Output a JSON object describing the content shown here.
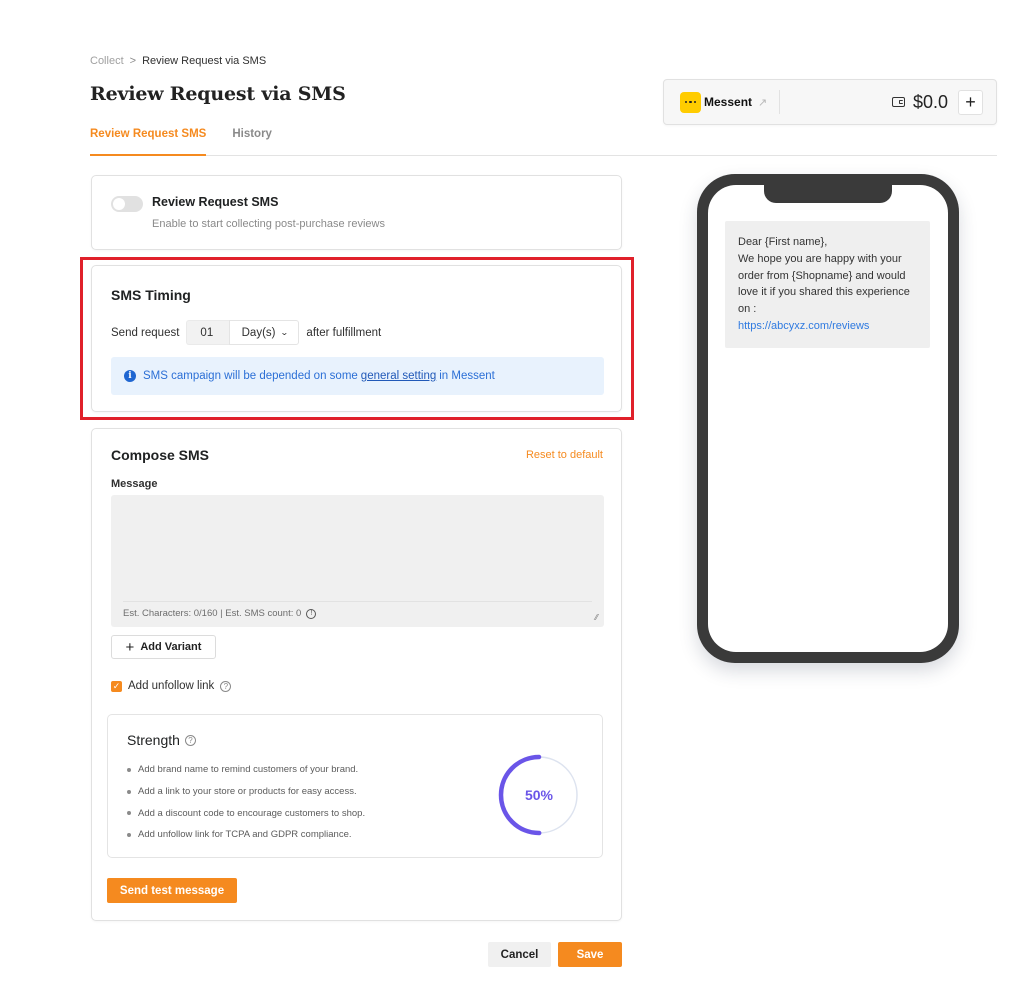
{
  "breadcrumb": {
    "parent": "Collect",
    "separator": ">",
    "current": "Review Request via SMS"
  },
  "page": {
    "title": "Review Request via SMS"
  },
  "tabs": [
    {
      "label": "Review Request SMS",
      "active": true
    },
    {
      "label": "History",
      "active": false
    }
  ],
  "wallet": {
    "brand_name": "Messent",
    "external_link_icon": "external-link-icon",
    "wallet_icon": "wallet-icon",
    "balance": "$0.0",
    "add_label": "+"
  },
  "review_toggle": {
    "title": "Review Request SMS",
    "description": "Enable to start collecting post-purchase reviews",
    "enabled": false
  },
  "timing": {
    "title": "SMS Timing",
    "prefix": "Send request",
    "amount": "01",
    "unit": "Day(s)",
    "suffix": "after fulfillment",
    "info_before": "SMS campaign will be depended on some",
    "info_link": "general setting",
    "info_after": "in Messent"
  },
  "compose": {
    "title": "Compose SMS",
    "reset_label": "Reset to default",
    "message_label": "Message",
    "message_value": "",
    "stats": "Est. Characters: 0/160 | Est. SMS count: 0",
    "add_variant_label": "Add Variant",
    "unfollow_label": "Add unfollow link",
    "unfollow_checked": true,
    "send_test_label": "Send test message"
  },
  "strength": {
    "title": "Strength",
    "tips": [
      "Add brand name to remind customers of your brand.",
      "Add a link to your store or products for easy access.",
      "Add a discount code to encourage customers to shop.",
      "Add unfollow link for TCPA and GDPR compliance."
    ],
    "percent": 50,
    "percent_label": "50%",
    "color": "#6a55e8",
    "track_color": "#dde3ef"
  },
  "footer": {
    "cancel_label": "Cancel",
    "save_label": "Save"
  },
  "preview": {
    "lines": [
      "Dear {First name},",
      "We hope you are happy with your order from {Shopname} and would love it if you shared this experience on :"
    ],
    "link": "https://abcyxz.com/reviews"
  },
  "colors": {
    "accent": "#f58a1f",
    "highlight": "#e0202a",
    "info_bg": "#e8f2fd",
    "info_text": "#2b6fd6",
    "brand_yellow": "#ffcc00"
  }
}
